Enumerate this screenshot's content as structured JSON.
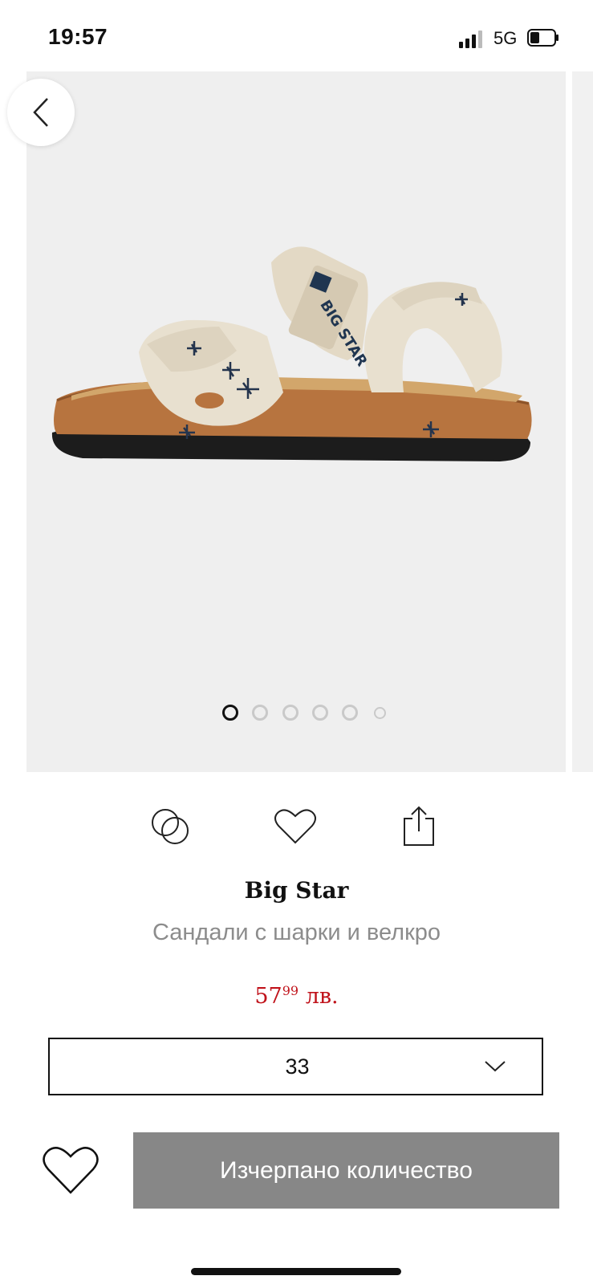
{
  "status": {
    "time": "19:57",
    "network": "5G"
  },
  "gallery": {
    "image_icon": "sandal-photo",
    "total_dots": 6,
    "active_index": 0
  },
  "actions": [
    "compare-icon",
    "heart-icon",
    "share-icon"
  ],
  "product": {
    "brand": "Big Star",
    "name": "Сандали с шарки и велкро",
    "price_main": "57",
    "price_cents": "99",
    "price_currency": "лв."
  },
  "size_select": {
    "value": "33"
  },
  "cta": {
    "label": "Изчерпано количество"
  },
  "colors": {
    "price": "#c0121a",
    "cta_bg": "#878787"
  }
}
